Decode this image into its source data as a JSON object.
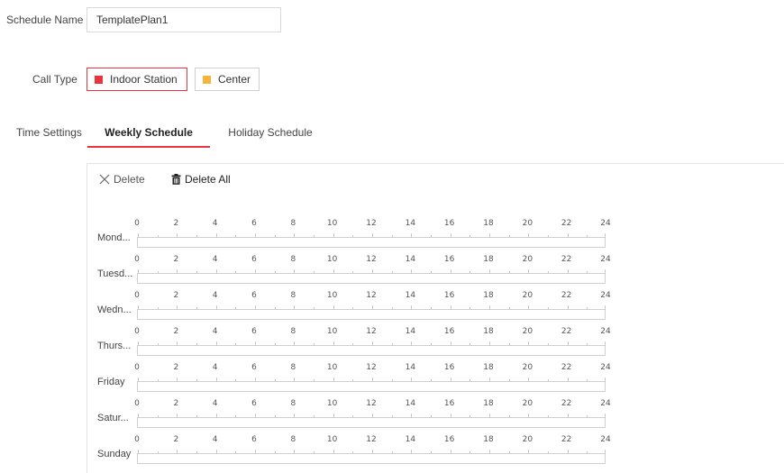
{
  "schedule_name": {
    "label": "Schedule Name",
    "value": "TemplatePlan1"
  },
  "call_type": {
    "label": "Call Type",
    "options": [
      {
        "label": "Indoor Station",
        "color": "#e8353b",
        "selected": true
      },
      {
        "label": "Center",
        "color": "#f5b53d",
        "selected": false
      }
    ]
  },
  "time_settings": {
    "label": "Time Settings",
    "tabs": [
      {
        "label": "Weekly Schedule",
        "active": true
      },
      {
        "label": "Holiday Schedule",
        "active": false
      }
    ]
  },
  "toolbar": {
    "delete_label": "Delete",
    "delete_all_label": "Delete All"
  },
  "hours": [
    "0",
    "2",
    "4",
    "6",
    "8",
    "10",
    "12",
    "14",
    "16",
    "18",
    "20",
    "22",
    "24"
  ],
  "days": [
    "Mond...",
    "Tuesd...",
    "Wedn...",
    "Thurs...",
    "Friday",
    "Satur...",
    "Sunday"
  ],
  "colors": {
    "accent": "#e8353b",
    "center": "#f5b53d"
  }
}
